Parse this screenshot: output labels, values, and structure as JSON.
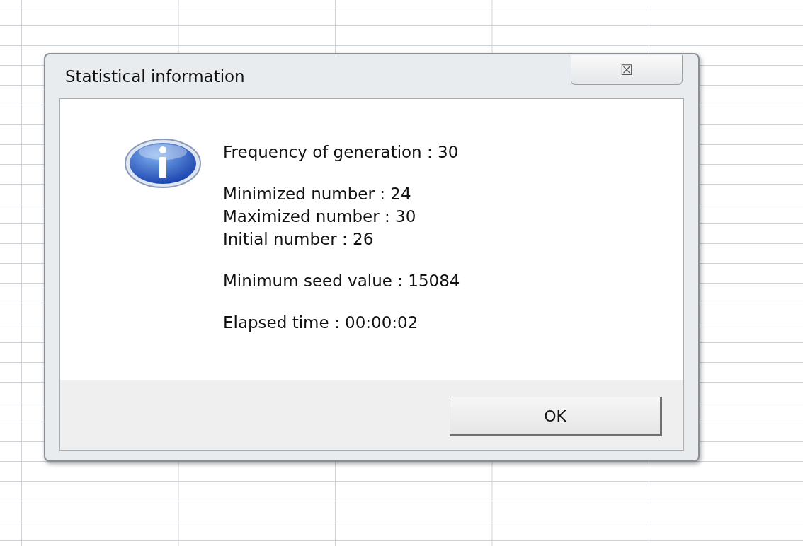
{
  "dialog": {
    "title": "Statistical information",
    "close_symbol": "☒",
    "message_groups": [
      [
        "Frequency of generation : 30"
      ],
      [
        "Minimized number : 24",
        "Maximized number : 30",
        "Initial number : 26"
      ],
      [
        "Minimum seed value : 15084"
      ],
      [
        "Elapsed time : 00:00:02"
      ]
    ],
    "buttons": [
      "OK"
    ]
  }
}
